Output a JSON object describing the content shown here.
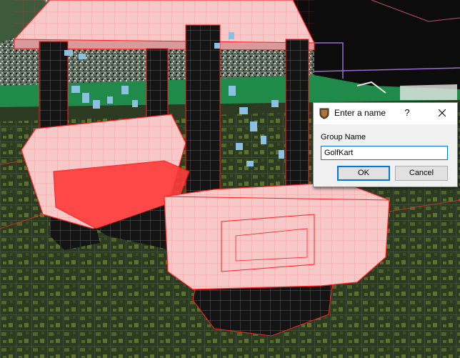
{
  "viewport": {
    "description_icon": "3d-wireframe-scene"
  },
  "dialog": {
    "title": "Enter a name",
    "help_label": "?",
    "close_icon": "close-icon",
    "app_icon": "shield-icon",
    "field_label": "Group Name",
    "input_value": "GolfKart",
    "ok_label": "OK",
    "cancel_label": "Cancel"
  },
  "colors": {
    "accent": "#0078d7",
    "wireframe": "#ff2020",
    "shape_fill": "#f6c8c8",
    "dark": "#1a1a1a",
    "glass": "#8cc0e0"
  }
}
